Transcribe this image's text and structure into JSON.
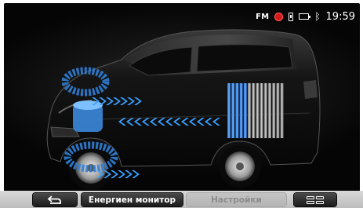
{
  "status": {
    "radio": "FM",
    "time": "19:59",
    "icons": [
      "record-icon",
      "phone-icon",
      "battery-icon",
      "bluetooth-icon"
    ]
  },
  "toolbar": {
    "back_icon": "back-arrow-icon",
    "energy_label": "Енергиен монитор",
    "settings_label": "Настройки",
    "menu_icon": "grid-menu-icon"
  },
  "colors": {
    "flow": "#3aa0ff",
    "battery_blue": "#3b88e6",
    "battery_gray": "#9a9a9a"
  }
}
